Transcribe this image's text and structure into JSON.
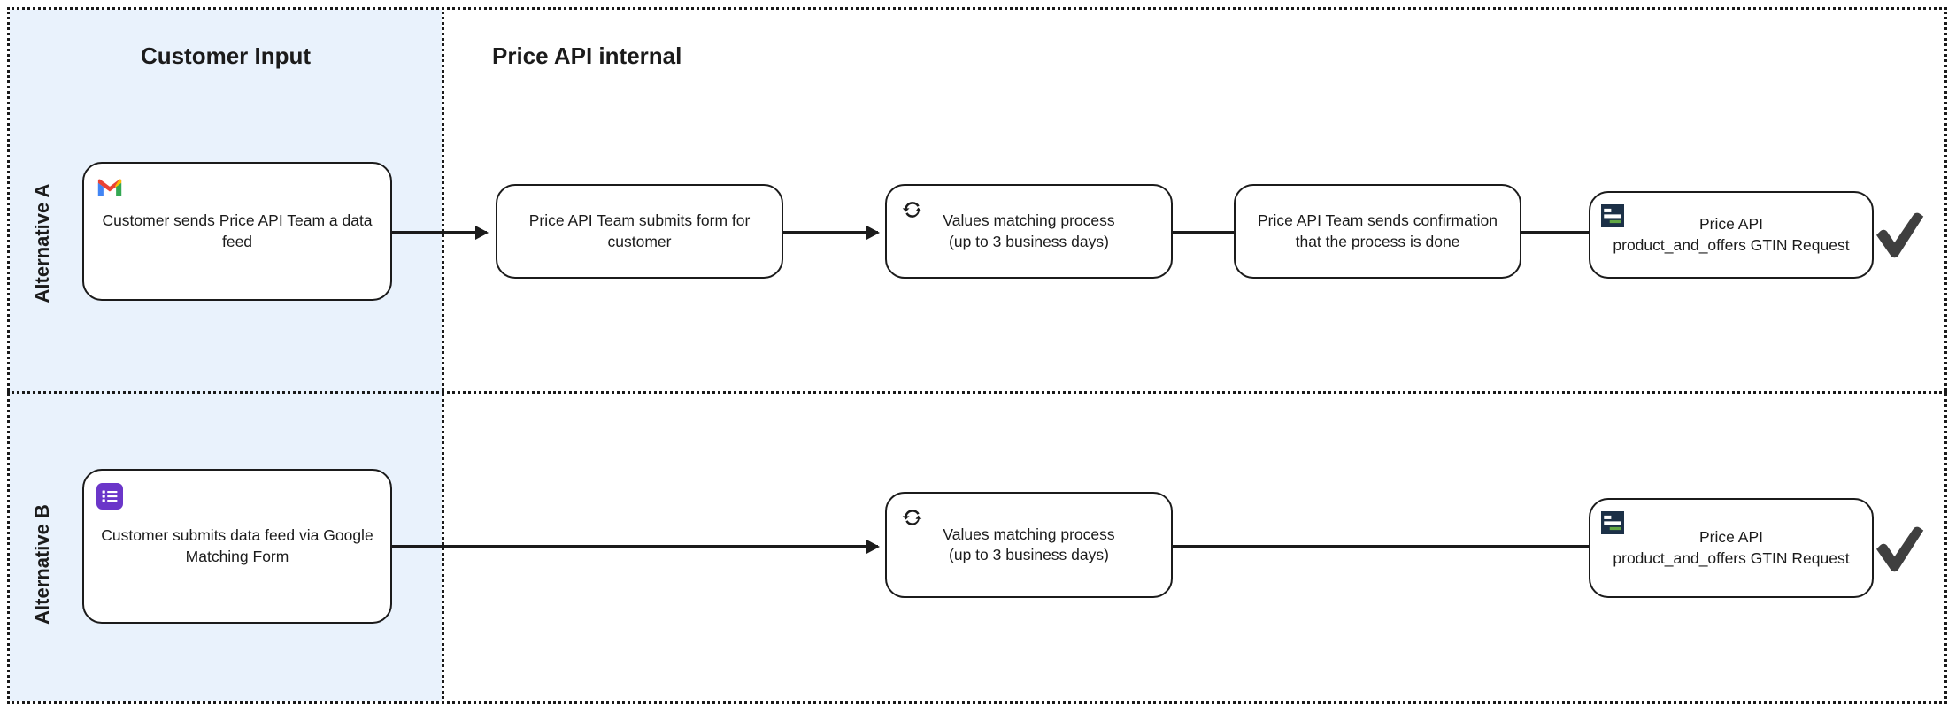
{
  "diagram": {
    "columns": [
      {
        "id": "customer-input",
        "title": "Customer Input"
      },
      {
        "id": "price-api-internal",
        "title": "Price API internal"
      }
    ],
    "rows": [
      {
        "id": "alternative-a",
        "label": "Alternative A"
      },
      {
        "id": "alternative-b",
        "label": "Alternative B"
      }
    ],
    "colors": {
      "lane_background": "#e9f2fc",
      "stroke": "#1b1b1b",
      "check": "#3f3f3f",
      "api_icon_navy": "#1c3047",
      "api_icon_green": "#62a744",
      "forms_purple": "#6b36c9",
      "gmail_red": "#ea4335",
      "gmail_blue": "#4285f4",
      "gmail_green": "#34a853",
      "gmail_yellow": "#fbbc04"
    },
    "nodes": [
      {
        "id": "a-customer-sends-feed",
        "row": "alternative-a",
        "column": "customer-input",
        "icon": "gmail-icon",
        "text": "Customer sends Price API Team a data feed"
      },
      {
        "id": "a-team-submits-form",
        "row": "alternative-a",
        "column": "price-api-internal",
        "icon": null,
        "text": "Price API Team submits form for customer"
      },
      {
        "id": "a-values-matching",
        "row": "alternative-a",
        "column": "price-api-internal",
        "icon": "sync-icon",
        "text": "Values matching process\n(up to 3 business days)"
      },
      {
        "id": "a-team-sends-confirmation",
        "row": "alternative-a",
        "column": "price-api-internal",
        "icon": null,
        "text": "Price API Team sends confirmation that the process is done"
      },
      {
        "id": "a-gtin-request",
        "row": "alternative-a",
        "column": "price-api-internal",
        "icon": "api-icon",
        "text": "Price API\nproduct_and_offers GTIN Request"
      },
      {
        "id": "b-customer-submits-form",
        "row": "alternative-b",
        "column": "customer-input",
        "icon": "forms-icon",
        "text": "Customer submits data feed via Google Matching Form"
      },
      {
        "id": "b-values-matching",
        "row": "alternative-b",
        "column": "price-api-internal",
        "icon": "sync-icon",
        "text": "Values matching process\n(up to 3 business days)"
      },
      {
        "id": "b-gtin-request",
        "row": "alternative-b",
        "column": "price-api-internal",
        "icon": "api-icon",
        "text": "Price API\nproduct_and_offers GTIN Request"
      }
    ],
    "end_markers": [
      {
        "id": "a-complete-check",
        "row": "alternative-a",
        "icon": "check-icon"
      },
      {
        "id": "b-complete-check",
        "row": "alternative-b",
        "icon": "check-icon"
      }
    ]
  }
}
